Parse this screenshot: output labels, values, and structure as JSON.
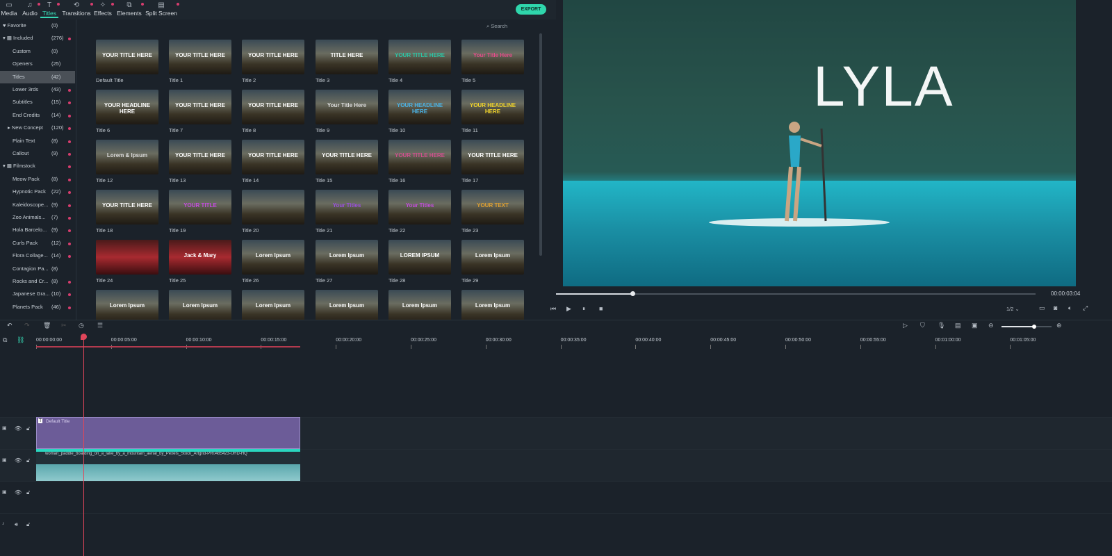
{
  "tabs": [
    {
      "label": "Media",
      "icon": "folder-icon"
    },
    {
      "label": "Audio",
      "icon": "music-icon"
    },
    {
      "label": "Titles",
      "icon": "text-icon",
      "active": true
    },
    {
      "label": "Transitions",
      "icon": "transition-icon"
    },
    {
      "label": "Effects",
      "icon": "effects-icon"
    },
    {
      "label": "Elements",
      "icon": "elements-icon"
    },
    {
      "label": "Split Screen",
      "icon": "split-screen-icon"
    }
  ],
  "export_label": "EXPORT",
  "search_placeholder": "Search",
  "sidebar": [
    {
      "label": "Favorite",
      "count": "(0)",
      "level": 0,
      "icon": "heart"
    },
    {
      "label": "Included",
      "count": "(276)",
      "level": 0,
      "icon": "grid",
      "dot": true
    },
    {
      "label": "Custom",
      "count": "(0)",
      "level": 1
    },
    {
      "label": "Openers",
      "count": "(25)",
      "level": 1
    },
    {
      "label": "Titles",
      "count": "(42)",
      "level": 1,
      "selected": true
    },
    {
      "label": "Lower 3rds",
      "count": "(43)",
      "level": 1,
      "dot": true
    },
    {
      "label": "Subtitles",
      "count": "(15)",
      "level": 1,
      "dot": true
    },
    {
      "label": "End Credits",
      "count": "(14)",
      "level": 1,
      "dot": true
    },
    {
      "label": "New Concept",
      "count": "(120)",
      "level": 1,
      "dot": true,
      "arrow": true
    },
    {
      "label": "Plain Text",
      "count": "(8)",
      "level": 1,
      "dot": true
    },
    {
      "label": "Callout",
      "count": "(9)",
      "level": 1,
      "dot": true
    },
    {
      "label": "Filmstock",
      "count": "",
      "level": 0,
      "icon": "filmstock",
      "dot": true
    },
    {
      "label": "Meow Pack",
      "count": "(8)",
      "level": 1,
      "dot": true
    },
    {
      "label": "Hypnotic Pack",
      "count": "(22)",
      "level": 1,
      "dot": true
    },
    {
      "label": "Kaleidoscope...",
      "count": "(9)",
      "level": 1,
      "dot": true
    },
    {
      "label": "Zoo Animals...",
      "count": "(7)",
      "level": 1,
      "dot": true
    },
    {
      "label": "Hola Barcelo...",
      "count": "(9)",
      "level": 1,
      "dot": true
    },
    {
      "label": "Curls Pack",
      "count": "(12)",
      "level": 1,
      "dot": true
    },
    {
      "label": "Flora Collage...",
      "count": "(14)",
      "level": 1,
      "dot": true
    },
    {
      "label": "Contagion Pa...",
      "count": "(8)",
      "level": 1
    },
    {
      "label": "Rocks and Cr...",
      "count": "(8)",
      "level": 1,
      "dot": true
    },
    {
      "label": "Japanese Gra...",
      "count": "(10)",
      "level": 1,
      "dot": true
    },
    {
      "label": "Planets Pack",
      "count": "(46)",
      "level": 1,
      "dot": true
    }
  ],
  "titles": [
    {
      "name": "Default Title",
      "text": "YOUR TITLE HERE"
    },
    {
      "name": "Title 1",
      "text": "YOUR TITLE HERE"
    },
    {
      "name": "Title 2",
      "text": "YOUR TITLE HERE"
    },
    {
      "name": "Title 3",
      "text": "TITLE HERE"
    },
    {
      "name": "Title 4",
      "text": "YOUR TITLE HERE"
    },
    {
      "name": "Title 5",
      "text": "Your Title Here"
    },
    {
      "name": "Title 6",
      "text": "YOUR HEADLINE HERE"
    },
    {
      "name": "Title 7",
      "text": "YOUR TITLE HERE"
    },
    {
      "name": "Title 8",
      "text": "YOUR TITLE HERE"
    },
    {
      "name": "Title 9",
      "text": "Your Title Here"
    },
    {
      "name": "Title 10",
      "text": "YOUR HEADLINE HERE"
    },
    {
      "name": "Title 11",
      "text": "YOUR HEADLINE HERE"
    },
    {
      "name": "Title 12",
      "text": "Lorem & Ipsum"
    },
    {
      "name": "Title 13",
      "text": "YOUR TITLE HERE"
    },
    {
      "name": "Title 14",
      "text": "YOUR TITLE HERE"
    },
    {
      "name": "Title 15",
      "text": "YOUR TITLE HERE"
    },
    {
      "name": "Title 16",
      "text": "YOUR TITLE HERE"
    },
    {
      "name": "Title 17",
      "text": "YOUR TITLE HERE"
    },
    {
      "name": "Title 18",
      "text": "YOUR TITLE HERE"
    },
    {
      "name": "Title 19",
      "text": "YOUR TITLE"
    },
    {
      "name": "Title 20",
      "text": ""
    },
    {
      "name": "Title 21",
      "text": "Your Titles"
    },
    {
      "name": "Title 22",
      "text": "Your Titles"
    },
    {
      "name": "Title 23",
      "text": "YOUR TEXT"
    },
    {
      "name": "Title 24",
      "text": ""
    },
    {
      "name": "Title 25",
      "text": "Jack & Mary"
    },
    {
      "name": "Title 26",
      "text": "Lorem Ipsum"
    },
    {
      "name": "Title 27",
      "text": "Lorem Ipsum"
    },
    {
      "name": "Title 28",
      "text": "LOREM IPSUM"
    },
    {
      "name": "Title 29",
      "text": "Lorem Ipsum"
    },
    {
      "name": "",
      "text": "Lorem Ipsum"
    },
    {
      "name": "",
      "text": "Lorem Ipsum"
    },
    {
      "name": "",
      "text": "Lorem Ipsum"
    },
    {
      "name": "",
      "text": "Lorem Ipsum"
    },
    {
      "name": "",
      "text": "Lorem Ipsum"
    },
    {
      "name": "",
      "text": "Lorem Ipsum"
    }
  ],
  "preview": {
    "overlay_title": "LYLA",
    "timecode": "00:00:03:04",
    "progress": 0.16,
    "quality": "1/2"
  },
  "timeline": {
    "ticks": [
      "00:00:00:00",
      "00:00:05:00",
      "00:00:10:00",
      "00:00:15:00",
      "00:00:20:00",
      "00:00:25:00",
      "00:00:30:00",
      "00:00:35:00",
      "00:00:40:00",
      "00:00:45:00",
      "00:00:50:00",
      "00:00:55:00",
      "00:01:00:00",
      "00:01:05:00"
    ],
    "zoom": 0.65,
    "title_clip": "Default Title",
    "video_clip": "woman_paddle_boarding_on_a_lake_by_a_mountain_aerial_by_Pexels_Stock_Artgrid-PR0485423-UHD-HQ"
  },
  "colors": {
    "accent": "#37d9b5",
    "title_clip": "#6c5c98",
    "playhead": "#e0465a"
  }
}
